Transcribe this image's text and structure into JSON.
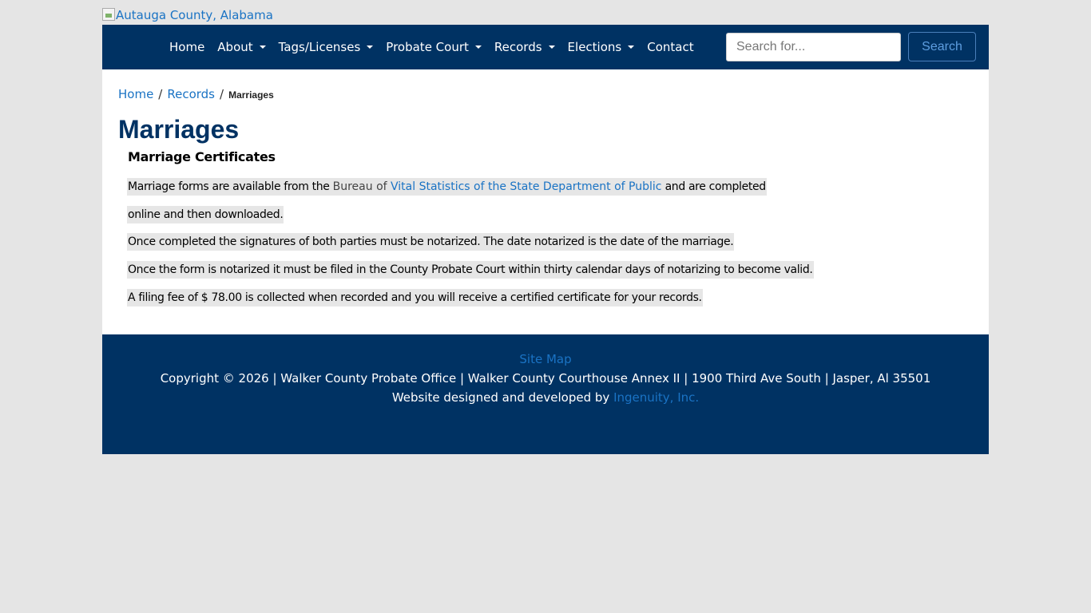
{
  "header": {
    "logo_alt": "Autauga County, Alabama"
  },
  "nav": {
    "items": [
      {
        "label": "Home",
        "dropdown": false
      },
      {
        "label": "About",
        "dropdown": true
      },
      {
        "label": "Tags/Licenses",
        "dropdown": true
      },
      {
        "label": "Probate Court",
        "dropdown": true
      },
      {
        "label": "Records",
        "dropdown": true
      },
      {
        "label": "Elections",
        "dropdown": true
      },
      {
        "label": "Contact",
        "dropdown": false
      }
    ],
    "search_placeholder": "Search for...",
    "search_button": "Search"
  },
  "breadcrumb": {
    "home": "Home",
    "sep1": "/",
    "records": "Records",
    "sep2": "/",
    "current": "Marriages"
  },
  "page": {
    "title": "Marriages",
    "subtitle": "Marriage Certificates",
    "p1_before": "Marriage forms are available from the ",
    "p1_gray": "Bureau of ",
    "p1_link": "Vital Statistics of the State Department of Public",
    "p1_after": " and are completed",
    "p2": "online and then downloaded.",
    "p3": "Once completed the signatures of both parties must be notarized. The date notarized is the date of the marriage.",
    "p4": "Once the form is notarized it must be filed in the County Probate Court within thirty calendar days of notarizing to become valid.",
    "p5": "A filing fee of $ 78.00 is collected when recorded and you will receive a certified certificate for your records."
  },
  "footer": {
    "sitemap": "Site Map",
    "copyright": "Copyright © 2026 | Walker County Probate Office | Walker County Courthouse Annex II | 1900 Third Ave South | Jasper, Al 35501",
    "credit_prefix": "Website designed and developed by ",
    "credit_link": "Ingenuity, Inc."
  },
  "colors": {
    "brand_navy": "#003263",
    "link_blue": "#1a73c4",
    "page_bg": "#e5e5e5",
    "text_highlight": "#e6e6e6"
  }
}
